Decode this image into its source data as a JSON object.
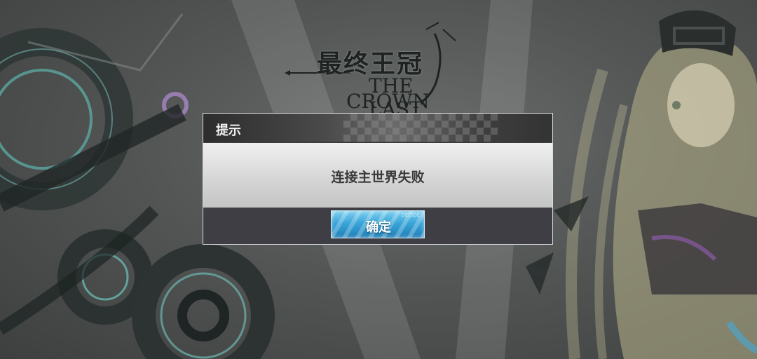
{
  "logo": {
    "title_cn": "最终王冠",
    "title_en_line1": "THE LAST",
    "title_en_line2": "CROWN"
  },
  "dialog": {
    "title": "提示",
    "message": "连接主世界失败",
    "confirm_label": "确定",
    "confirm_sublabel": "DECIDE"
  },
  "colors": {
    "dialog_body": "#d8d8d8",
    "button_accent": "#3aa5d8",
    "background": "#4a4c4b"
  }
}
